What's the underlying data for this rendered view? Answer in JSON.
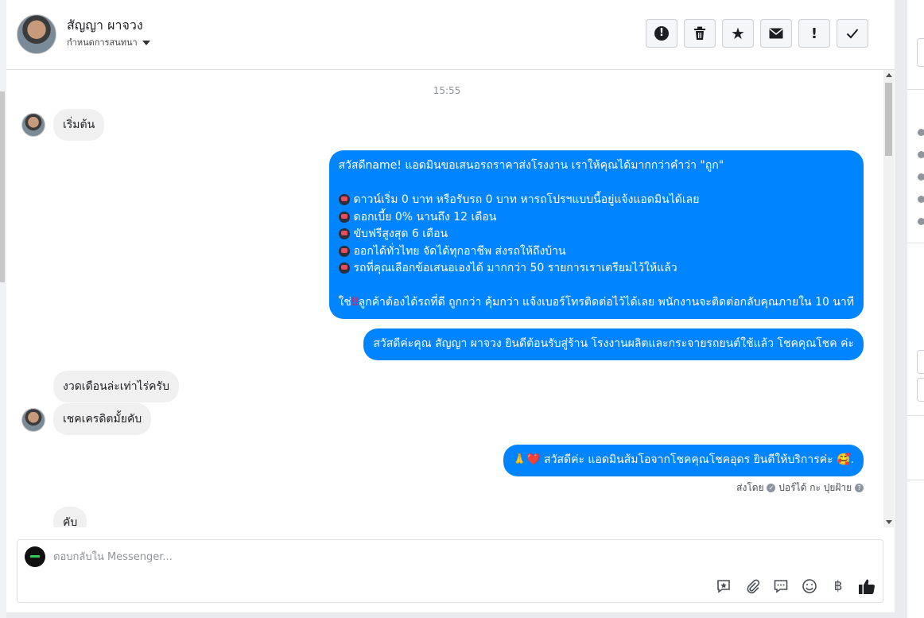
{
  "header": {
    "contact_name": "สัญญา ผาจวง",
    "subtitle": "กำหนดการสนทนา",
    "buttons": [
      {
        "icon": "alert-circle-icon",
        "glyph": "!"
      },
      {
        "icon": "trash-icon",
        "glyph": "🗑"
      },
      {
        "icon": "star-icon",
        "glyph": "★"
      },
      {
        "icon": "envelope-icon",
        "glyph": "✉"
      },
      {
        "icon": "exclamation-icon",
        "glyph": "!"
      },
      {
        "icon": "checkmark-icon",
        "glyph": "✓"
      }
    ]
  },
  "chat": {
    "timestamp": "15:55",
    "msg_in_1": "เริ่มต้น",
    "msg_out_promo": {
      "intro": "สวัสดีname! แอดมินขอเสนอรถราคาส่งโรงงาน เราให้คุณได้มากกว่าคำว่า \"ถูก\"",
      "items": [
        "ดาวน์เริ่ม 0 บาท หรือรับรถ 0 บาท หารถโปรฯแบบนี้อยู่แจ้งแอดมินได้เลย",
        "ดอกเบี้ย 0% นานถึง 12 เดือน",
        "ขับฟรีสูงสุด 6 เดือน",
        "ออกได้ทั่วไทย จัดได้ทุกอาชีพ ส่งรถให้ถึงบ้าน",
        "รถที่คุณเลือกข้อเสนอเองได้ มากกว่า 50 รายการเราเตรียมไว้ให้แล้ว"
      ],
      "outro_prefix": "ใช่",
      "outro_mark": "‼",
      "outro": "ลูกค้าต้องได้รถที่ดี ถูกกว่า คุ้มกว่า แจ้งเบอร์โทรติดต่อไว้ได้เลย พนักงานจะติดต่อกลับคุณภายใน 10 นาที"
    },
    "msg_out_welcome": "สวัสดีค่ะคุณ สัญญา ผาจวง ยินดีต้อนรับสู่ร้าน โรงงานผลิตและกระจายรถยนต์ใช้แล้ว โชคคุณโชค ค่ะ",
    "msg_in_2": "งวดเดือนล่ะเท่าไร่ครับ",
    "msg_in_3": "เชคเครดิตมั้ยคับ",
    "msg_out_admin": {
      "prefix": "🙏❤️",
      "text": "สวัสดีค่ะ แอดมินส้มโอจากโชคคุณโชคอุดร ยินดีให้บริการค่ะ",
      "suffix": "🥰."
    },
    "sent_by": {
      "label": "ส่งโดย",
      "name": "ปอร์ได้ กะ ปุยฝ้าย"
    },
    "msg_in_4": "คับ"
  },
  "composer": {
    "placeholder": "ตอบกลับใน Messenger...",
    "tools": [
      "saved-reply-icon",
      "attachment-icon",
      "comment-icon",
      "emoji-icon",
      "baht-icon",
      "like-icon"
    ]
  },
  "colors": {
    "outgoing_bubble": "#0084ff",
    "incoming_bubble": "#f1f0f0",
    "emphasis": "#e0245e"
  }
}
